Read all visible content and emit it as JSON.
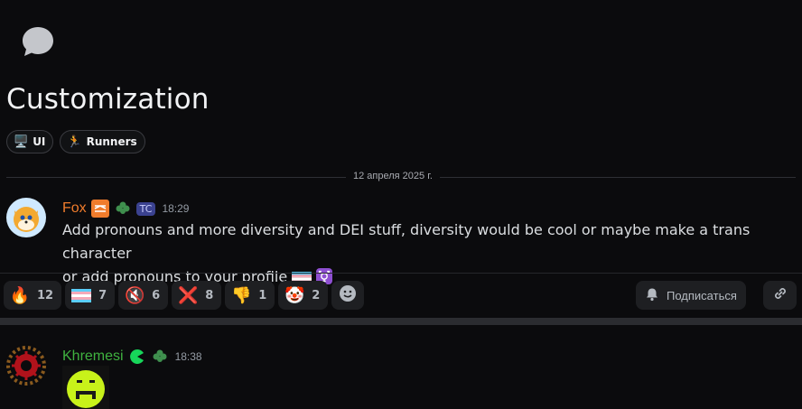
{
  "thread": {
    "title": "Customization",
    "tags": [
      {
        "emoji": "🖥️",
        "label": "UI"
      },
      {
        "emoji": "🏃",
        "label": "Runners"
      }
    ]
  },
  "date_divider": "12 апреля 2025 г.",
  "messages": [
    {
      "author": "Fox",
      "tag": "TC",
      "time": "18:29",
      "lines": [
        "Add pronouns and more diversity and DEI stuff, diversity would be cool or maybe make a trans character",
        "or add pronouns to your profile"
      ],
      "reactions": [
        {
          "icon": "fire-icon",
          "emoji": "🔥",
          "count": "12"
        },
        {
          "icon": "trans-flag-icon",
          "emoji": "",
          "count": "7"
        },
        {
          "icon": "muted-speaker-icon",
          "emoji": "🔇",
          "count": "6"
        },
        {
          "icon": "cross-mark-icon",
          "emoji": "❌",
          "count": "8"
        },
        {
          "icon": "thumbs-down-icon",
          "emoji": "👎",
          "count": "1"
        },
        {
          "icon": "clown-icon",
          "emoji": "🤡",
          "count": "2"
        }
      ]
    },
    {
      "author": "Khremesi",
      "time": "18:38"
    }
  ],
  "actions": {
    "follow_label": "Подписаться"
  },
  "colors": {
    "background": "#0b0b0d",
    "fox_name": "#f07c2c",
    "khremesi_name": "#3fb23f",
    "reaction_bg": "#1e1f22"
  }
}
